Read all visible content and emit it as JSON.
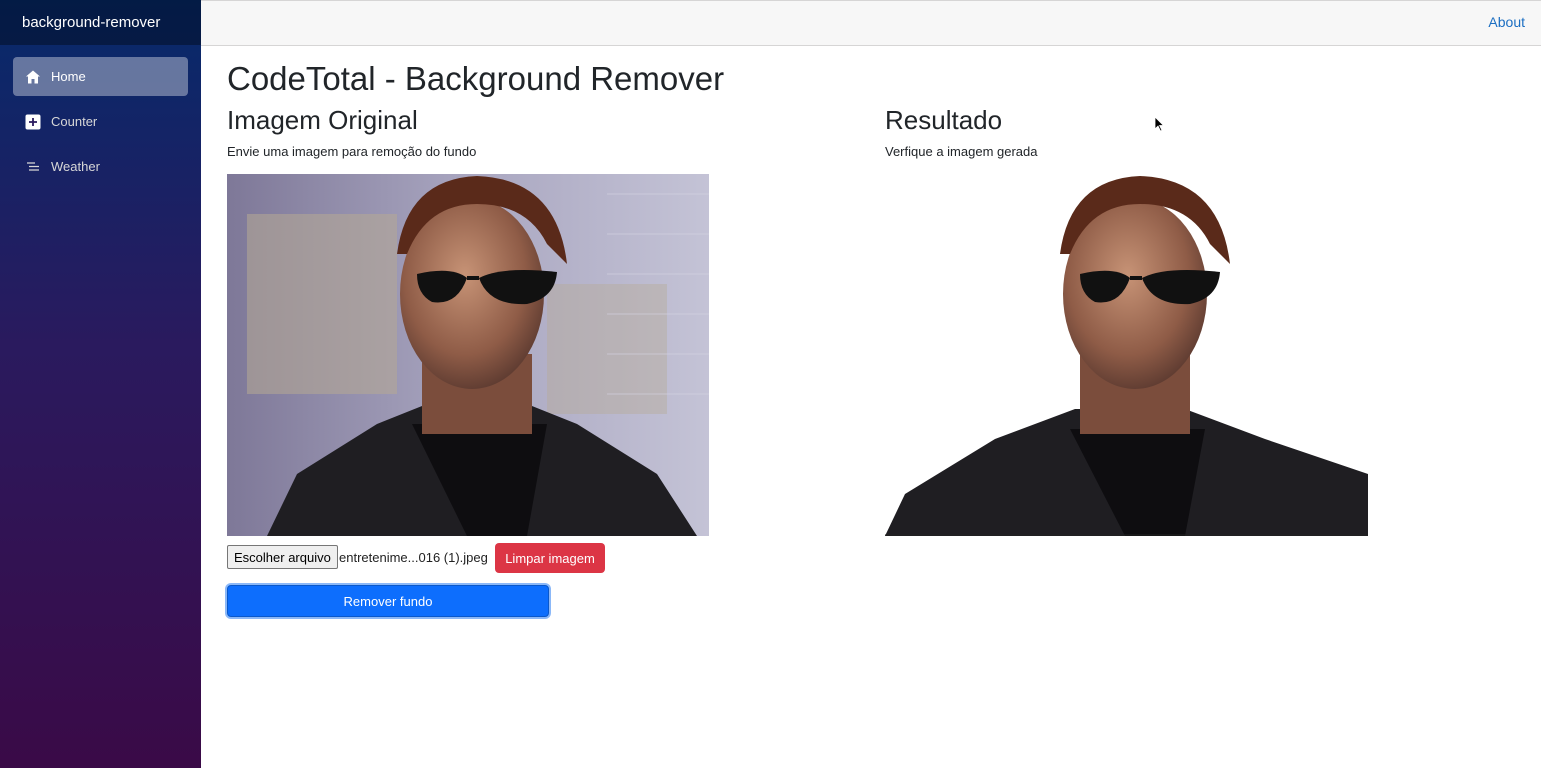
{
  "app": {
    "brand": "background-remover"
  },
  "nav": {
    "items": [
      {
        "label": "Home",
        "icon": "home-icon",
        "active": true
      },
      {
        "label": "Counter",
        "icon": "plus-icon",
        "active": false
      },
      {
        "label": "Weather",
        "icon": "list-icon",
        "active": false
      }
    ]
  },
  "topbar": {
    "about": "About"
  },
  "page": {
    "title": "CodeTotal - Background Remover",
    "original": {
      "title": "Imagem Original",
      "subtitle": "Envie uma imagem para remoção do fundo"
    },
    "result": {
      "title": "Resultado",
      "subtitle": "Verfique a imagem gerada"
    },
    "file": {
      "button": "Escolher arquivo",
      "name": "entretenime...016 (1).jpeg"
    },
    "clear_button": "Limpar imagem",
    "remove_button": "Remover fundo"
  },
  "colors": {
    "accent": "#0d6efd",
    "danger": "#dc3545",
    "link": "#1b6ec2",
    "sidebar_top": "#062a6b",
    "sidebar_bottom": "#3a0a47"
  }
}
